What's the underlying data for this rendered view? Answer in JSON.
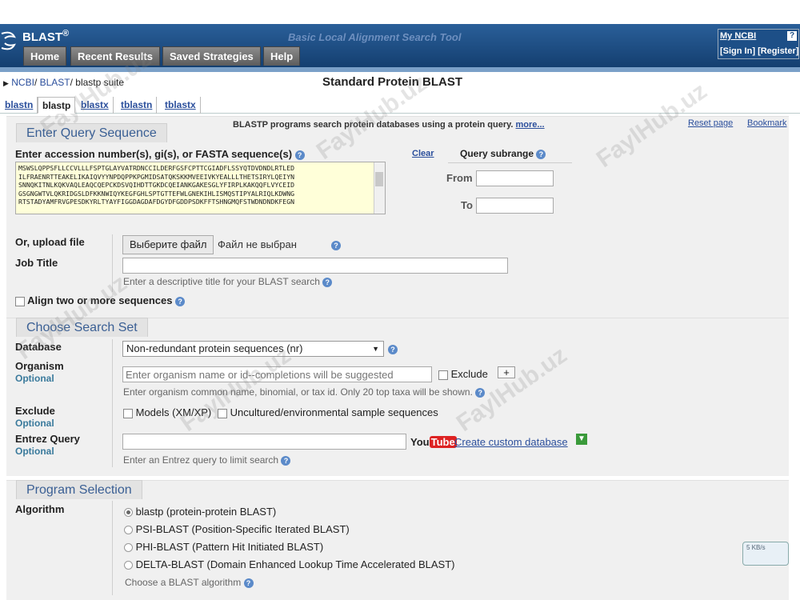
{
  "header": {
    "logo": "BLAST",
    "logo_reg": "®",
    "tagline": "Basic Local Alignment Search Tool",
    "nav": [
      "Home",
      "Recent Results",
      "Saved Strategies",
      "Help"
    ],
    "myncbi": "My NCBI",
    "help_badge": "?",
    "sign_in": "[Sign In]",
    "register": "[Register]"
  },
  "breadcrumb": {
    "ncbi": "NCBI",
    "blast": "BLAST",
    "current": "blastp suite"
  },
  "page_title": "Standard Protein BLAST",
  "tabs": [
    "blastn",
    "blastp",
    "blastx",
    "tblastn",
    "tblastx"
  ],
  "active_tab": "blastp",
  "intro": {
    "text": "BLASTP programs search protein databases using a protein query.",
    "more": "more...",
    "reset": "Reset page",
    "bookmark": "Bookmark"
  },
  "query": {
    "heading": "Enter Query Sequence",
    "label": "Enter accession number(s), gi(s), or FASTA sequence(s)",
    "clear": "Clear",
    "subrange_title": "Query subrange",
    "from_label": "From",
    "to_label": "To",
    "sequence_lines": [
      "MSWSLQPPSFLLCCVLLLFSPTGLAYVATRDNCCILDERFGSFCPTTCGIADFLSSYQTDVDNDLRTLED",
      "ILFRAENRTTEAKELIKAIQVYYNPDQPPKPGMIDSATQKSKKMVEEIVKYEALLLTHETSIRYLQEIYN",
      "SNNQKITNLKQKVAQLEAQCQEPCKDSVQIHDTTGKDCQEIANKGAKESGLYFIRPLKAKQQFLVYCEID",
      "GSGNGWTVLQKRIDGSLDFKKNWIQYKEGFGHLSPTGTTEFWLGNEKIHLISMQSTIPYALRIQLKDWNG",
      "RTSTADYAMFRVGPESDKYRLTYAYFIGGDAGDAFDGYDFGDDPSDKFFTSHNGMQFSTWDNDNDKFEGN"
    ],
    "upload_label": "Or, upload file",
    "upload_button": "Выберите файл",
    "upload_status": "Файл не выбран",
    "job_title_label": "Job Title",
    "job_title_value": "",
    "job_title_hint": "Enter a descriptive title for your BLAST search",
    "align_two": "Align two or more sequences"
  },
  "search_set": {
    "heading": "Choose Search Set",
    "database_label": "Database",
    "database_value": "Non-redundant protein sequences (nr)",
    "organism_label": "Organism",
    "optional": "Optional",
    "organism_placeholder": "Enter organism name or id--completions will be suggested",
    "exclude_check": "Exclude",
    "plus": "+",
    "organism_hint": "Enter organism common name, binomial, or tax id. Only 20 top taxa will be shown.",
    "exclude_label": "Exclude",
    "models": "Models (XM/XP)",
    "uncultured": "Uncultured/environmental sample sequences",
    "entrez_label": "Entrez Query",
    "entrez_value": "",
    "youtube_you": "You",
    "youtube_tube": "Tube",
    "custom_db": "Create custom database",
    "entrez_hint": "Enter an Entrez query to limit search"
  },
  "program": {
    "heading": "Program Selection",
    "algorithm_label": "Algorithm",
    "options": [
      "blastp (protein-protein BLAST)",
      "PSI-BLAST (Position-Specific Iterated BLAST)",
      "PHI-BLAST (Pattern Hit Initiated BLAST)",
      "DELTA-BLAST (Domain Enhanced Lookup Time Accelerated BLAST)"
    ],
    "selected": 0,
    "hint": "Choose a BLAST algorithm"
  },
  "watermark": "FaylHub.uz",
  "widget": {
    "text": "5 KB/s"
  }
}
